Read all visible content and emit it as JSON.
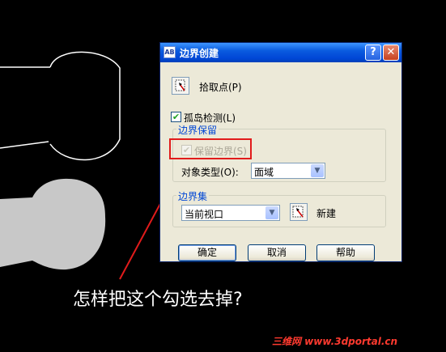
{
  "dialog": {
    "title": "边界创建",
    "title_icon_text": "AB",
    "help_button": "?",
    "close_button": "✕",
    "pick_points_label": "拾取点(P)",
    "island_detection": {
      "label": "孤岛检测(L)",
      "checked": true
    },
    "boundary_retention": {
      "group_title": "边界保留",
      "retain_boundaries": {
        "label": "保留边界(S)",
        "checked": true,
        "enabled": false
      },
      "object_type_label": "对象类型(O):",
      "object_type_value": "面域"
    },
    "boundary_set": {
      "group_title": "边界集",
      "value": "当前视口",
      "new_label": "新建"
    },
    "buttons": {
      "ok": "确定",
      "cancel": "取消",
      "help": "帮助"
    }
  },
  "annotation": {
    "question": "怎样把这个勾选去掉?",
    "watermark": "三维网 www.3dportal.cn",
    "highlight_color": "#E11B1B"
  }
}
